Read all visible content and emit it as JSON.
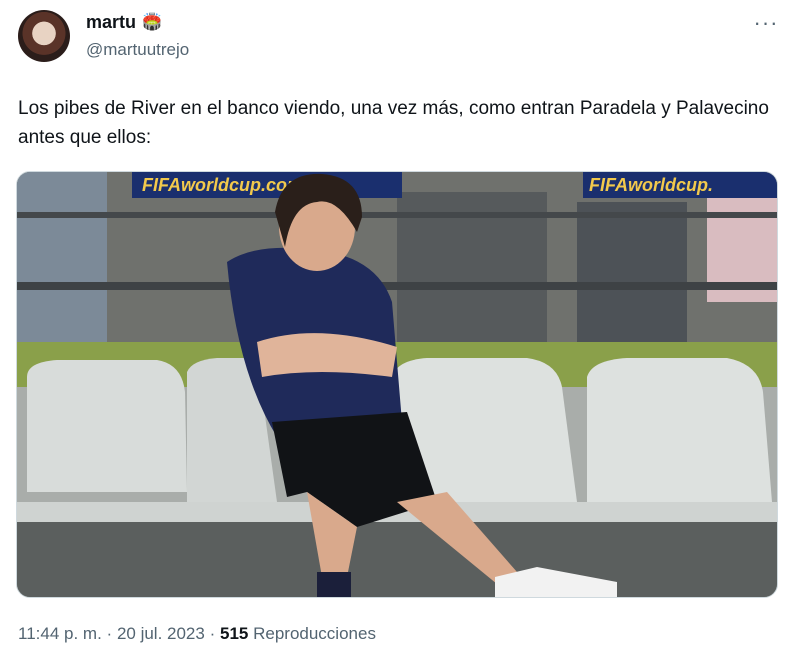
{
  "tweet": {
    "display_name": "martu",
    "name_emoji": "🏟️",
    "handle": "@martuutrejo",
    "text": "Los pibes de River en el banco viendo, una vez más, como entran Paradela y Palavecino antes que ellos:",
    "media": {
      "banner_left": "FIFAworldcup.com",
      "banner_right": "FIFAworldcup."
    },
    "time": "11:44 p. m.",
    "date": "20 jul. 2023",
    "views_count": "515",
    "views_label": "Reproducciones",
    "separator": "·"
  },
  "icons": {
    "more": "more-icon",
    "badge": "stadium-icon"
  }
}
